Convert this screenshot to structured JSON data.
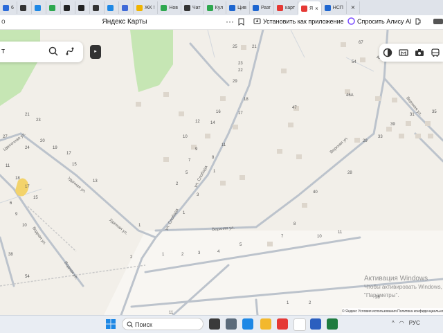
{
  "browser": {
    "tabs": [
      {
        "label": "6",
        "fav": "#2a6ad9"
      },
      {
        "label": "",
        "fav": "#333"
      },
      {
        "label": "",
        "fav": "#1e88e5"
      },
      {
        "label": "",
        "fav": "#2ea84f"
      },
      {
        "label": "",
        "fav": "#222"
      },
      {
        "label": "",
        "fav": "#222"
      },
      {
        "label": "",
        "fav": "#333"
      },
      {
        "label": "",
        "fav": "#1e88e5"
      },
      {
        "label": "",
        "fav": "#3f6ad8"
      },
      {
        "label": "ЖК !",
        "fav": "#f0b400"
      },
      {
        "label": "Нов",
        "fav": "#2ea84f"
      },
      {
        "label": "Чат",
        "fav": "#333"
      },
      {
        "label": "Кул",
        "fav": "#2ea84f"
      },
      {
        "label": "Цив",
        "fav": "#1e66d0"
      },
      {
        "label": "Разг",
        "fav": "#1e66d0"
      },
      {
        "label": "карт",
        "fav": "#e53935"
      },
      {
        "label": "Я",
        "fav": "#e53935",
        "active": true
      },
      {
        "label": "НСП",
        "fav": "#1e66d0"
      }
    ],
    "new_tab_glyph": "×",
    "close_glyph": "×",
    "address_fragment": "о",
    "page_title": "Яндекс Карты",
    "menu_glyph": "···",
    "install_label": "Установить как приложение",
    "alice_label": "Спросить Алису AI"
  },
  "map": {
    "search_fragment": "т",
    "collapse_glyph": "▸",
    "streets": {
      "sloboda": "ул. Слобода",
      "verkhnyaya1": "Верхняя ул.",
      "verkhnyaya2": "Верхняя ул.",
      "verkhnyaya3": "Верхняя ул.",
      "udachnaya1": "Удачная ул.",
      "udachnaya2": "Удачная ул.",
      "vodnaya1": "Водная ул.",
      "vodnaya2": "Водная ул.",
      "tsvetnaya": "Цветочная ул."
    },
    "house_numbers": [
      "21",
      "25",
      "23",
      "27",
      "24",
      "22",
      "20",
      "19",
      "18",
      "17",
      "16",
      "15",
      "14",
      "13",
      "12",
      "11",
      "10",
      "9",
      "8",
      "7",
      "6",
      "5",
      "4",
      "3",
      "2",
      "1",
      "29",
      "40",
      "36",
      "38",
      "67",
      "54",
      "41",
      "43",
      "46A",
      "47",
      "33",
      "35",
      "31",
      "39",
      "28"
    ],
    "attribution": "© Яндекс  Условия использования  Политика конфиденциальности",
    "watermark_title": "Активация Windows",
    "watermark_line1": "Чтобы активировать Windows,",
    "watermark_line2": "\"Параметры\"."
  },
  "taskbar": {
    "search_label": "Поиск",
    "lang": "РУС"
  }
}
